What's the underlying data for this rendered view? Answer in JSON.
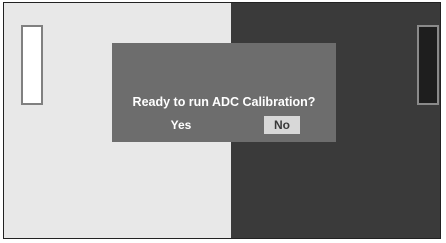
{
  "dialog": {
    "message": "Ready to run ADC Calibration?",
    "yes_label": "Yes",
    "no_label": "No",
    "selected": "No"
  },
  "colors": {
    "left_panel": "#e8e8e8",
    "right_panel": "#3a3a3a",
    "dialog_background": "#6d6d6d",
    "white_patch": "#ffffff",
    "black_patch": "#1e1e1e",
    "selected_button": "#d8d8d8"
  }
}
